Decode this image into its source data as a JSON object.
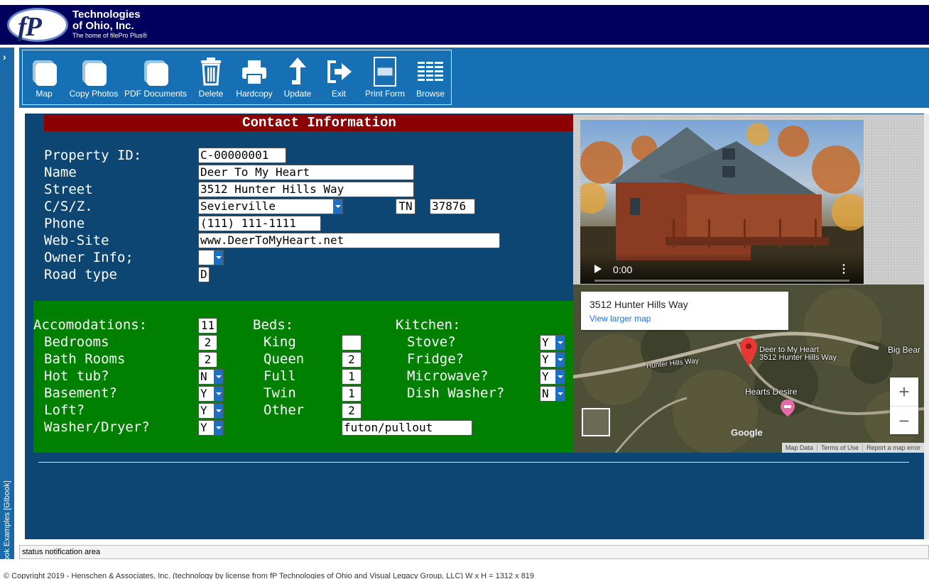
{
  "header": {
    "logo_mark": "fP",
    "company_line1": "Technologies",
    "company_line2": "of Ohio, Inc.",
    "tagline": "The home of filePro Plus®"
  },
  "sidebar": {
    "chevron": "›",
    "vertical_label": "Test GIbook Examples [GIbook]"
  },
  "toolbar": {
    "map": "Map",
    "copy_photos": "Copy Photos",
    "pdf_documents": "PDF Documents",
    "delete": "Delete",
    "hardcopy": "Hardcopy",
    "update": "Update",
    "exit": "Exit",
    "print_form": "Print Form",
    "browse": "Browse"
  },
  "form": {
    "title": "Contact Information",
    "labels": {
      "property_id": "Property ID:",
      "name": "Name",
      "street": "Street",
      "csz": "C/S/Z.",
      "phone": "Phone",
      "website": "Web-Site",
      "owner_info": "Owner Info;",
      "road_type": "Road type"
    },
    "values": {
      "property_id": "C-00000001",
      "name": "Deer To My Heart",
      "street": "3512 Hunter Hills Way",
      "city": "Sevierville",
      "state": "TN",
      "zip": "37876",
      "phone": "(111) 111-1111",
      "website": "www.DeerToMyHeart.net",
      "owner_info": "",
      "road_type": "D"
    }
  },
  "amenities": {
    "accommodations_label": "Accomodations:",
    "accommodations": "11",
    "bedrooms_label": "Bedrooms",
    "bedrooms": "2",
    "bathrooms_label": "Bath Rooms",
    "bathrooms": "2",
    "hot_tub_label": "Hot tub?",
    "hot_tub": "N",
    "basement_label": "Basement?",
    "basement": "Y",
    "loft_label": "Loft?",
    "loft": "Y",
    "washer_dryer_label": "Washer/Dryer?",
    "washer_dryer": "Y",
    "beds_label": "Beds:",
    "king_label": "King",
    "king": "",
    "queen_label": "Queen",
    "queen": "2",
    "full_label": "Full",
    "full": "1",
    "twin_label": "Twin",
    "twin": "1",
    "other_label": "Other",
    "other": "2",
    "other_desc": "futon/pullout",
    "kitchen_label": "Kitchen:",
    "stove_label": "Stove?",
    "stove": "Y",
    "fridge_label": "Fridge?",
    "fridge": "Y",
    "microwave_label": "Microwave?",
    "microwave": "Y",
    "dishwasher_label": "Dish Washer?",
    "dishwasher": "N"
  },
  "video": {
    "time": "0:00",
    "more": "⋮"
  },
  "map": {
    "card_title": "3512 Hunter Hills Way",
    "card_link": "View larger map",
    "pin_label_1": "Deer to My Heart",
    "pin_label_2": "3512 Hunter Hills Way",
    "road_label": "Hunter Hills Way",
    "place_label": "Hearts Desire",
    "edge_label": "Big Bear",
    "google": "Google",
    "zoom_in": "+",
    "zoom_out": "−",
    "footer_map_data": "Map Data",
    "footer_terms": "Terms of Use",
    "footer_report": "Report a map error"
  },
  "status": {
    "text": "status notification area"
  },
  "footer": {
    "copyright": "© Copyright 2019 - Henschen & Associates, Inc. (technology by license from fP Technologies of Ohio and Visual Legacy Group, LLC)   W x H = 1312 x 819"
  },
  "colors": {
    "header_bg": "#00005e",
    "toolbar_bg": "#1670b3",
    "panel_bg": "#0d4672",
    "title_bg": "#8b0000",
    "amenities_bg": "#008000",
    "dropdown_arrow": "#1f6fc0"
  }
}
